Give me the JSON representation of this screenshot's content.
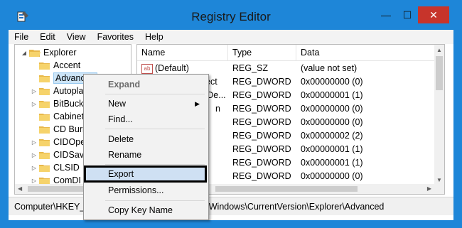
{
  "window": {
    "title": "Registry Editor"
  },
  "titlebar_buttons": {
    "minimize": "—",
    "maximize": "☐",
    "close": "✕"
  },
  "menu": [
    "File",
    "Edit",
    "View",
    "Favorites",
    "Help"
  ],
  "tree": {
    "root": "Explorer",
    "items": [
      "Accent",
      "Advanced",
      "Autopla",
      "BitBuck",
      "Cabinet",
      "CD Burn",
      "CIDOpe",
      "CIDSav",
      "CLSID",
      "ComDI"
    ]
  },
  "list": {
    "columns": [
      "Name",
      "Type",
      "Data"
    ],
    "rows": [
      {
        "name": "(Default)",
        "type": "REG_SZ",
        "data": "(value not set)"
      },
      {
        "name": "ect",
        "type": "REG_DWORD",
        "data": "0x00000000 (0)"
      },
      {
        "name": "vDe...",
        "type": "REG_DWORD",
        "data": "0x00000001 (1)"
      },
      {
        "name": "n",
        "type": "REG_DWORD",
        "data": "0x00000000 (0)"
      },
      {
        "name": "",
        "type": "REG_DWORD",
        "data": "0x00000000 (0)"
      },
      {
        "name": "",
        "type": "REG_DWORD",
        "data": "0x00000002 (2)"
      },
      {
        "name": "",
        "type": "REG_DWORD",
        "data": "0x00000001 (1)"
      },
      {
        "name": "",
        "type": "REG_DWORD",
        "data": "0x00000001 (1)"
      },
      {
        "name": "",
        "type": "REG_DWORD",
        "data": "0x00000000 (0)"
      }
    ]
  },
  "status": {
    "left": "Computer\\HKEY_C",
    "right": "oft\\Windows\\CurrentVersion\\Explorer\\Advanced"
  },
  "context_menu": {
    "items": [
      "Expand",
      "New",
      "Find...",
      "Delete",
      "Rename",
      "Export",
      "Permissions...",
      "Copy Key Name"
    ]
  }
}
